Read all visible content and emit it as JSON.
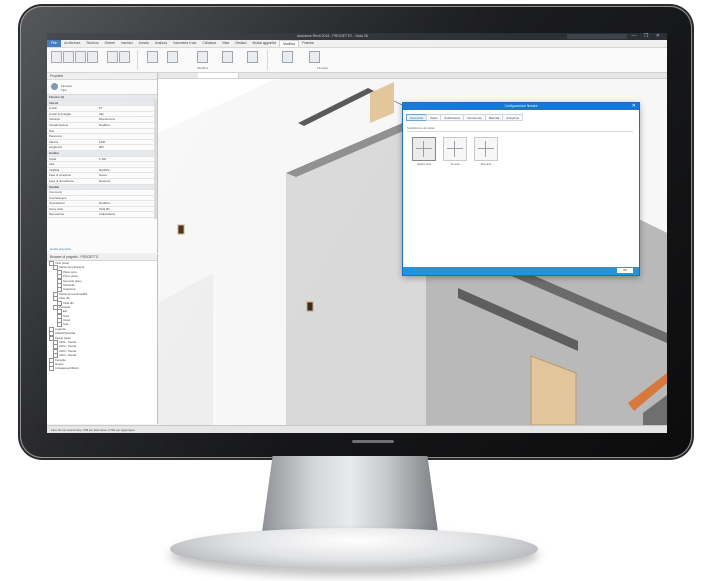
{
  "colors": {
    "accent": "#1976d2",
    "dialog_footer": "#1f94e0",
    "file_tab": "#2a6cb8",
    "wall_grey": "#a2a2a2",
    "door_wood": "#e2c59a",
    "rail_orange": "#d9783c"
  },
  "app": {
    "titlebar_text": "Autodesk Revit 2018 - PROGETTO - Vista 3D",
    "window_controls": "— ❐ ✕"
  },
  "menubar": {
    "file_label": "File",
    "tabs": [
      "Architettura",
      "Struttura",
      "Sistemi",
      "Inserisci",
      "Annota",
      "Analizza",
      "Volumetria e sito",
      "Collabora",
      "Vista",
      "Gestisci",
      "Moduli aggiuntivi",
      "Modifica",
      "Finestra"
    ],
    "active_index": 11
  },
  "ribbon": {
    "groups": [
      "Modifica",
      "Finestra"
    ]
  },
  "properties": {
    "header": "Proprietà",
    "type_name": "Finestra",
    "type_sub": "Tipo",
    "rows": [
      {
        "cat": true,
        "k": "Finestre (1)",
        "v": ""
      },
      {
        "cat": true,
        "k": "Vincoli",
        "v": ""
      },
      {
        "k": "Livello",
        "v": "PT"
      },
      {
        "k": "Livello di dettaglio",
        "v": "Alto"
      },
      {
        "k": "Sottotipo",
        "v": "Rivestimento"
      },
      {
        "k": "Visualizzazione",
        "v": "Modifica..."
      },
      {
        "k": "Dati",
        "v": ""
      },
      {
        "k": "Parametro",
        "v": ""
      },
      {
        "k": "Altezza",
        "v": "1200"
      },
      {
        "k": "Larghezza",
        "v": "900"
      },
      {
        "cat": true,
        "k": "Grafica",
        "v": ""
      },
      {
        "k": "Scala",
        "v": "1:100"
      },
      {
        "k": "Stile",
        "v": ""
      },
      {
        "k": "Visibilità",
        "v": "Modifica..."
      },
      {
        "k": "Fase di creazione",
        "v": "Nuovo"
      },
      {
        "k": "Fase di demolizione",
        "v": "Nessuna"
      },
      {
        "cat": true,
        "k": "Identità",
        "v": ""
      },
      {
        "k": "Commenti",
        "v": ""
      },
      {
        "k": "Contrassegno",
        "v": ""
      },
      {
        "k": "Impostazioni",
        "v": "Modifica..."
      },
      {
        "k": "Nome vista",
        "v": "Vista 3D"
      },
      {
        "k": "Dipendenza",
        "v": "Indipendente"
      }
    ],
    "footer_link": "Guida proprietà"
  },
  "browser": {
    "header": "Browser di progetto - PROGETTO",
    "items": [
      {
        "lvl": 0,
        "t": "Viste (tutte)"
      },
      {
        "lvl": 1,
        "t": "Piante dei pavimenti"
      },
      {
        "lvl": 2,
        "t": "Piano terra"
      },
      {
        "lvl": 2,
        "t": "Primo piano"
      },
      {
        "lvl": 2,
        "t": "Secondo piano"
      },
      {
        "lvl": 2,
        "t": "Sottotetto"
      },
      {
        "lvl": 2,
        "t": "Copertura"
      },
      {
        "lvl": 1,
        "t": "Piante dei controsoffitti"
      },
      {
        "lvl": 1,
        "t": "Viste 3D"
      },
      {
        "lvl": 2,
        "t": "Vista 3D"
      },
      {
        "lvl": 1,
        "t": "Prospetti"
      },
      {
        "lvl": 2,
        "t": "Est"
      },
      {
        "lvl": 2,
        "t": "Nord"
      },
      {
        "lvl": 2,
        "t": "Ovest"
      },
      {
        "lvl": 2,
        "t": "Sud"
      },
      {
        "lvl": 0,
        "t": "Legende"
      },
      {
        "lvl": 0,
        "t": "Abachi/Quantità"
      },
      {
        "lvl": 0,
        "t": "Tavole (tutte)"
      },
      {
        "lvl": 1,
        "t": "A101 - Tavola"
      },
      {
        "lvl": 1,
        "t": "A102 - Tavola"
      },
      {
        "lvl": 1,
        "t": "A103 - Tavola"
      },
      {
        "lvl": 1,
        "t": "A104 - Tavola"
      },
      {
        "lvl": 0,
        "t": "Famiglie"
      },
      {
        "lvl": 0,
        "t": "Gruppi"
      },
      {
        "lvl": 0,
        "t": "Collegamenti Revit"
      }
    ]
  },
  "dialog": {
    "title": "Configurazione finestra",
    "close": "✕",
    "tabs": [
      "Geometria",
      "Telaio",
      "Suddivisione",
      "Ferramenta",
      "Materiali",
      "Anteprima"
    ],
    "active_tab": 0,
    "section_label": "Suddivisione del telaio",
    "options": [
      {
        "label": "Quattro ante",
        "selected": true
      },
      {
        "label": "Tre ante",
        "selected": false
      },
      {
        "label": "Due ante",
        "selected": false
      }
    ],
    "ok_label": "OK"
  },
  "statusbar": {
    "text": "Fare clic per selezionare, TAB per alternative, CTRL per aggiungere"
  }
}
